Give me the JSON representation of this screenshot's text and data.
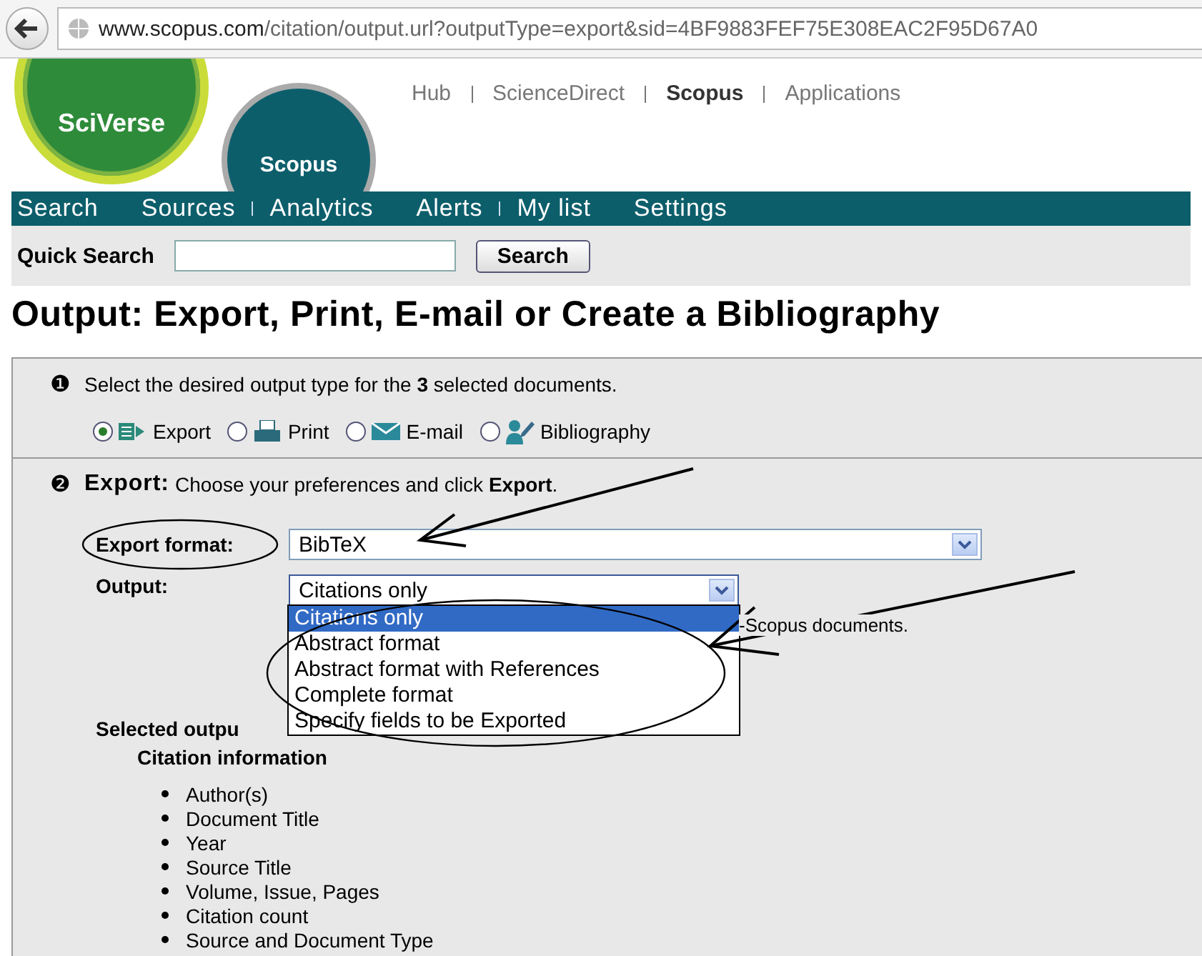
{
  "address_bar": {
    "url_host": "www.scopus.com",
    "url_path": "/citation/output.url?outputType=export&sid=4BF9883FEF75E308EAC2F95D67A0"
  },
  "logos": {
    "sciverse": "SciVerse",
    "scopus": "Scopus"
  },
  "header_links": [
    {
      "label": "Hub",
      "selected": false
    },
    {
      "label": "ScienceDirect",
      "selected": false
    },
    {
      "label": "Scopus",
      "selected": true
    },
    {
      "label": "Applications",
      "selected": false
    }
  ],
  "nav": [
    {
      "label": "Search",
      "divider_after": false
    },
    {
      "label": "Sources",
      "divider_after": true
    },
    {
      "label": "Analytics",
      "divider_after": false
    },
    {
      "label": "Alerts",
      "divider_after": true
    },
    {
      "label": "My list",
      "divider_after": false
    },
    {
      "label": "Settings",
      "divider_after": false
    }
  ],
  "quick_search": {
    "label": "Quick Search",
    "button": "Search"
  },
  "page_title": "Output: Export, Print, E-mail or Create a Bibliography",
  "step1": {
    "marker": "❶",
    "text": "Select the desired output type for the **3** selected documents."
  },
  "output_types": [
    {
      "label": "Export",
      "kind": "export",
      "selected": true
    },
    {
      "label": "Print",
      "kind": "print",
      "selected": false
    },
    {
      "label": "E-mail",
      "kind": "email",
      "selected": false
    },
    {
      "label": "Bibliography",
      "kind": "bibliography",
      "selected": false
    }
  ],
  "step2": {
    "marker": "❷",
    "heading": "Export:",
    "text": "Choose your preferences and click **Export**."
  },
  "export_format": {
    "label": "Export format:",
    "value": "BibTeX"
  },
  "output": {
    "label": "Output:",
    "value": "Citations only",
    "expanded": true,
    "options": [
      {
        "label": "Citations only",
        "selected": true
      },
      {
        "label": "Abstract format",
        "selected": false
      },
      {
        "label": "Abstract format with References",
        "selected": false
      },
      {
        "label": "Complete format",
        "selected": false
      },
      {
        "label": "Specify fields to be Exported",
        "selected": false
      }
    ]
  },
  "hidden_note": "-Scopus documents.",
  "selected_output_label": "Selected outpu",
  "citation_heading": "Citation information",
  "fields": [
    "Author(s)",
    "Document Title",
    "Year",
    "Source Title",
    "Volume, Issue, Pages",
    "Citation count",
    "Source and Document Type"
  ]
}
